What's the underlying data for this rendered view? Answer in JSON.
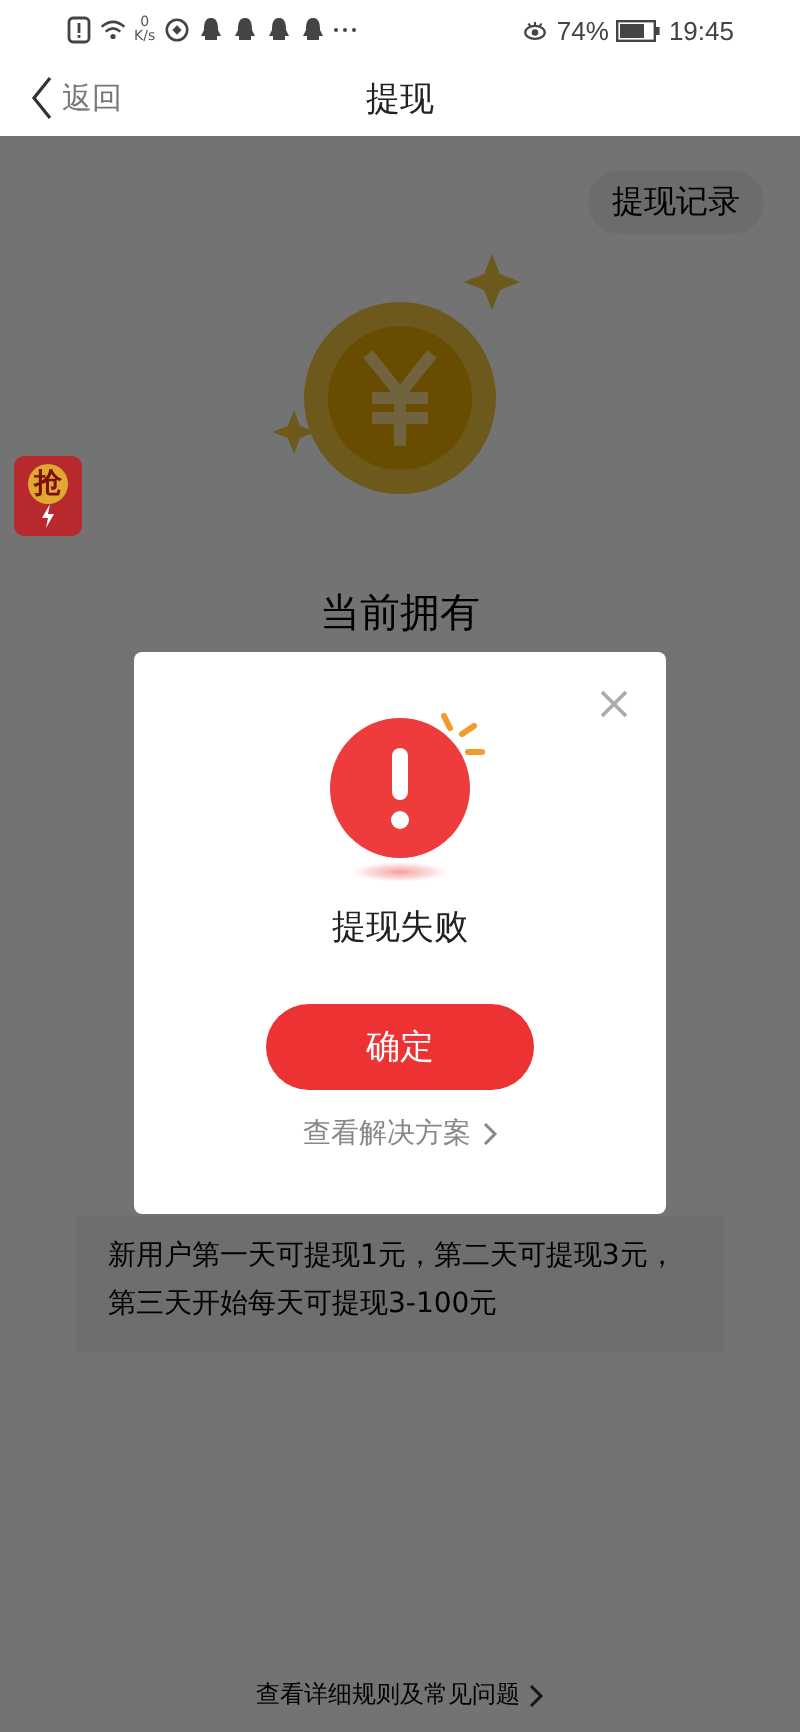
{
  "status_bar": {
    "speed_value": "0",
    "speed_unit": "K/s",
    "battery": "74%",
    "time": "19:45"
  },
  "nav": {
    "back_label": "返回",
    "title": "提现"
  },
  "records_button": "提现记录",
  "float_badge": "抢",
  "balance_label": "当前拥有",
  "notice": "新用户第一天可提现1元，第二天可提现3元，第三天开始每天可提现3-100元",
  "rules_link": "查看详细规则及常见问题",
  "dialog": {
    "message": "提现失败",
    "confirm": "确定",
    "solution_link": "查看解决方案"
  }
}
